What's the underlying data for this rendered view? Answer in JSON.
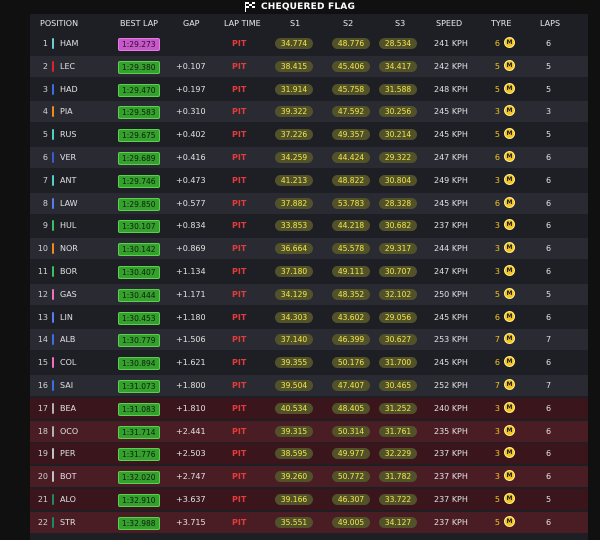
{
  "title": "CHEQUERED FLAG",
  "headers": {
    "position": "POSITION",
    "best_lap": "BEST LAP",
    "gap": "GAP",
    "lap_time": "LAP TIME",
    "s1": "S1",
    "s2": "S2",
    "s3": "S3",
    "speed": "SPEED",
    "tyre": "TYRE",
    "laps": "LAPS"
  },
  "tyre_label": "M",
  "rows": [
    {
      "pos": "1",
      "driver": "HAM",
      "best": "1:29.273",
      "best_type": "fastest",
      "gap": "",
      "lap": "PIT",
      "s1": "34.774",
      "s2": "48.776",
      "s3": "28.534",
      "speed": "241 KPH",
      "tyre": "6",
      "laps": "6",
      "team_color": "#6ad0c8"
    },
    {
      "pos": "2",
      "driver": "LEC",
      "best": "1:29.380",
      "best_type": "personal",
      "gap": "+0.107",
      "lap": "PIT",
      "s1": "38.415",
      "s2": "45.406",
      "s3": "34.417",
      "speed": "242 KPH",
      "tyre": "5",
      "laps": "5",
      "team_color": "#e0202a"
    },
    {
      "pos": "3",
      "driver": "HAD",
      "best": "1:29.470",
      "best_type": "personal",
      "gap": "+0.197",
      "lap": "PIT",
      "s1": "31.914",
      "s2": "45.758",
      "s3": "31.588",
      "speed": "248 KPH",
      "tyre": "5",
      "laps": "5",
      "team_color": "#3d6ee0"
    },
    {
      "pos": "4",
      "driver": "PIA",
      "best": "1:29.583",
      "best_type": "personal",
      "gap": "+0.310",
      "lap": "PIT",
      "s1": "39.322",
      "s2": "47.592",
      "s3": "30.256",
      "speed": "245 KPH",
      "tyre": "3",
      "laps": "3",
      "team_color": "#f08a1a"
    },
    {
      "pos": "5",
      "driver": "RUS",
      "best": "1:29.675",
      "best_type": "personal",
      "gap": "+0.402",
      "lap": "PIT",
      "s1": "37.226",
      "s2": "49.357",
      "s3": "30.214",
      "speed": "245 KPH",
      "tyre": "5",
      "laps": "5",
      "team_color": "#4fd0c0"
    },
    {
      "pos": "6",
      "driver": "VER",
      "best": "1:29.689",
      "best_type": "personal",
      "gap": "+0.416",
      "lap": "PIT",
      "s1": "34.259",
      "s2": "44.424",
      "s3": "29.322",
      "speed": "247 KPH",
      "tyre": "6",
      "laps": "6",
      "team_color": "#3a5ad0"
    },
    {
      "pos": "7",
      "driver": "ANT",
      "best": "1:29.746",
      "best_type": "personal",
      "gap": "+0.473",
      "lap": "PIT",
      "s1": "41.213",
      "s2": "48.822",
      "s3": "30.804",
      "speed": "249 KPH",
      "tyre": "3",
      "laps": "6",
      "team_color": "#4fd0c0"
    },
    {
      "pos": "8",
      "driver": "LAW",
      "best": "1:29.850",
      "best_type": "personal",
      "gap": "+0.577",
      "lap": "PIT",
      "s1": "37.882",
      "s2": "53.783",
      "s3": "28.328",
      "speed": "245 KPH",
      "tyre": "6",
      "laps": "6",
      "team_color": "#5a7af0"
    },
    {
      "pos": "9",
      "driver": "HUL",
      "best": "1:30.107",
      "best_type": "personal",
      "gap": "+0.834",
      "lap": "PIT",
      "s1": "33.853",
      "s2": "44.218",
      "s3": "30.682",
      "speed": "237 KPH",
      "tyre": "3",
      "laps": "6",
      "team_color": "#3ac060"
    },
    {
      "pos": "10",
      "driver": "NOR",
      "best": "1:30.142",
      "best_type": "personal",
      "gap": "+0.869",
      "lap": "PIT",
      "s1": "36.664",
      "s2": "45.578",
      "s3": "29.317",
      "speed": "244 KPH",
      "tyre": "3",
      "laps": "6",
      "team_color": "#f08a1a"
    },
    {
      "pos": "11",
      "driver": "BOR",
      "best": "1:30.407",
      "best_type": "personal",
      "gap": "+1.134",
      "lap": "PIT",
      "s1": "37.180",
      "s2": "49.111",
      "s3": "30.707",
      "speed": "247 KPH",
      "tyre": "3",
      "laps": "6",
      "team_color": "#3ac060"
    },
    {
      "pos": "12",
      "driver": "GAS",
      "best": "1:30.444",
      "best_type": "personal",
      "gap": "+1.171",
      "lap": "PIT",
      "s1": "34.129",
      "s2": "48.352",
      "s3": "32.102",
      "speed": "250 KPH",
      "tyre": "5",
      "laps": "5",
      "team_color": "#f070c0"
    },
    {
      "pos": "13",
      "driver": "LIN",
      "best": "1:30.453",
      "best_type": "personal",
      "gap": "+1.180",
      "lap": "PIT",
      "s1": "34.303",
      "s2": "43.602",
      "s3": "29.056",
      "speed": "245 KPH",
      "tyre": "6",
      "laps": "6",
      "team_color": "#5a7af0"
    },
    {
      "pos": "14",
      "driver": "ALB",
      "best": "1:30.779",
      "best_type": "personal",
      "gap": "+1.506",
      "lap": "PIT",
      "s1": "37.140",
      "s2": "46.399",
      "s3": "30.627",
      "speed": "253 KPH",
      "tyre": "7",
      "laps": "7",
      "team_color": "#3a70e0"
    },
    {
      "pos": "15",
      "driver": "COL",
      "best": "1:30.894",
      "best_type": "personal",
      "gap": "+1.621",
      "lap": "PIT",
      "s1": "39.355",
      "s2": "50.176",
      "s3": "31.700",
      "speed": "245 KPH",
      "tyre": "6",
      "laps": "6",
      "team_color": "#f070c0"
    },
    {
      "pos": "16",
      "driver": "SAI",
      "best": "1:31.073",
      "best_type": "personal",
      "gap": "+1.800",
      "lap": "PIT",
      "s1": "39.504",
      "s2": "47.407",
      "s3": "30.465",
      "speed": "252 KPH",
      "tyre": "7",
      "laps": "7",
      "team_color": "#3a70e0"
    },
    {
      "pos": "17",
      "driver": "BEA",
      "best": "1:31.083",
      "best_type": "personal",
      "gap": "+1.810",
      "lap": "PIT",
      "s1": "40.534",
      "s2": "48.405",
      "s3": "31.252",
      "speed": "240 KPH",
      "tyre": "3",
      "laps": "6",
      "team_color": "#b0b0b8"
    },
    {
      "pos": "18",
      "driver": "OCO",
      "best": "1:31.714",
      "best_type": "personal",
      "gap": "+2.441",
      "lap": "PIT",
      "s1": "39.315",
      "s2": "50.314",
      "s3": "31.761",
      "speed": "235 KPH",
      "tyre": "3",
      "laps": "6",
      "team_color": "#b0b0b8"
    },
    {
      "pos": "19",
      "driver": "PER",
      "best": "1:31.776",
      "best_type": "personal",
      "gap": "+2.503",
      "lap": "PIT",
      "s1": "38.595",
      "s2": "49.977",
      "s3": "32.229",
      "speed": "237 KPH",
      "tyre": "3",
      "laps": "6",
      "team_color": "#c0c0c8"
    },
    {
      "pos": "20",
      "driver": "BOT",
      "best": "1:32.020",
      "best_type": "personal",
      "gap": "+2.747",
      "lap": "PIT",
      "s1": "39.260",
      "s2": "50.772",
      "s3": "31.782",
      "speed": "237 KPH",
      "tyre": "3",
      "laps": "6",
      "team_color": "#c0c0c8"
    },
    {
      "pos": "21",
      "driver": "ALO",
      "best": "1:32.910",
      "best_type": "personal",
      "gap": "+3.637",
      "lap": "PIT",
      "s1": "39.166",
      "s2": "46.307",
      "s3": "33.722",
      "speed": "237 KPH",
      "tyre": "5",
      "laps": "5",
      "team_color": "#1a8a6a"
    },
    {
      "pos": "22",
      "driver": "STR",
      "best": "1:32.988",
      "best_type": "personal",
      "gap": "+3.715",
      "lap": "PIT",
      "s1": "35.551",
      "s2": "49.005",
      "s3": "34.127",
      "speed": "237 KPH",
      "tyre": "5",
      "laps": "6",
      "team_color": "#1a8a6a"
    }
  ]
}
